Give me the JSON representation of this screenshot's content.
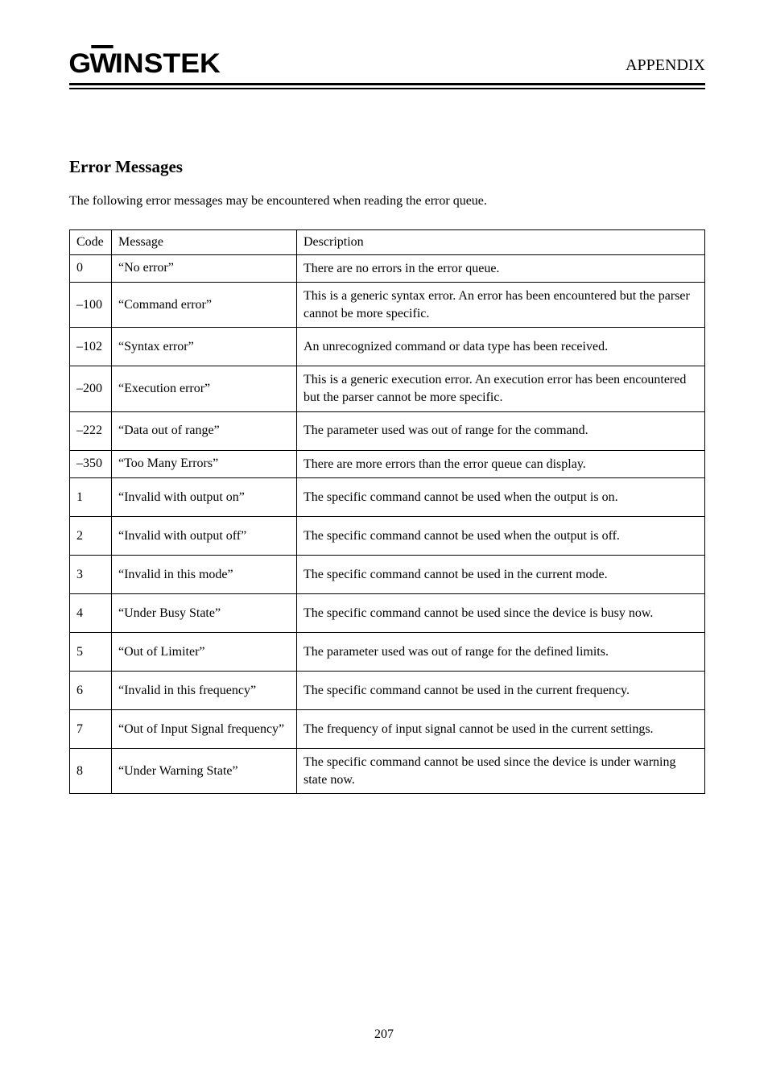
{
  "header": {
    "logo_g": "G",
    "logo_w": "W",
    "logo_rest": "INSTEK",
    "right_text": "APPENDIX"
  },
  "appendix": {
    "title": "Error Messages",
    "description": "The following error messages may be encountered when reading the error queue."
  },
  "table": {
    "headers": {
      "code": "Code",
      "message": "Message",
      "description": "Description"
    },
    "rows": [
      {
        "code": "0",
        "msg": "“No error”",
        "desc": "There are no errors in the error queue.",
        "h": "short"
      },
      {
        "code": "–100",
        "msg": "“Command error”",
        "desc": "This is a generic syntax error. An error has been encountered but the parser cannot be more specific.",
        "h": "tall"
      },
      {
        "code": "–102",
        "msg": "“Syntax error”",
        "desc": "An unrecognized command or data type has been received.",
        "h": "tall"
      },
      {
        "code": "–200",
        "msg": "“Execution error”",
        "desc": "This is a generic execution error. An execution error has been encountered but the parser cannot be more specific.",
        "h": "tall"
      },
      {
        "code": "–222",
        "msg": "“Data out of range”",
        "desc": "The parameter used was out of range for the command.",
        "h": "tall"
      },
      {
        "code": "–350",
        "msg": "“Too Many Errors”",
        "desc": "There are more errors than the error queue can display.",
        "h": "short"
      },
      {
        "code": "1",
        "msg": "“Invalid with output on”",
        "desc": "The specific command cannot be used when the output is on.",
        "h": "tall"
      },
      {
        "code": "2",
        "msg": "“Invalid with output off”",
        "desc": "The specific command cannot be used when the output is off.",
        "h": "tall"
      },
      {
        "code": "3",
        "msg": "“Invalid in this mode”",
        "desc": "The specific command cannot be used in the current mode.",
        "h": "tall"
      },
      {
        "code": "4",
        "msg": "“Under Busy State”",
        "desc": "The specific command cannot be used since the device is busy now.",
        "h": "tall"
      },
      {
        "code": "5",
        "msg": "“Out of Limiter”",
        "desc": "The parameter used was out of range for the defined limits.",
        "h": "tall"
      },
      {
        "code": "6",
        "msg": "“Invalid in this frequency”",
        "desc": "The specific command cannot be used in the current frequency.",
        "h": "tall"
      },
      {
        "code": "7",
        "msg": "“Out of Input Signal frequency”",
        "desc": "The frequency of input signal cannot be used in the current settings.",
        "h": "tall"
      },
      {
        "code": "8",
        "msg": "“Under Warning State”",
        "desc": "The specific command cannot be used since the device is under warning state now.",
        "h": "tall"
      }
    ]
  },
  "footer": {
    "page_number": "207"
  }
}
